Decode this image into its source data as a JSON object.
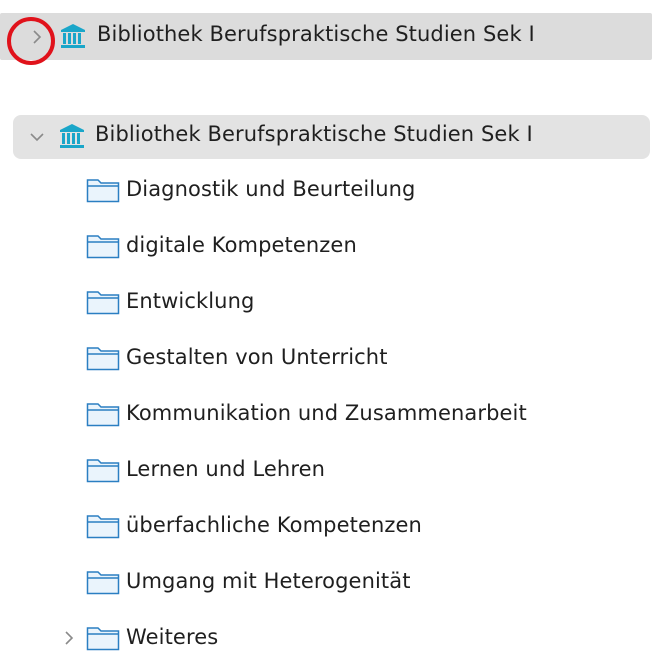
{
  "top_row": {
    "label": "Bibliothek Berufspraktische Studien Sek I",
    "chevron_icon": "chevron-right-icon",
    "library_icon": "library-icon"
  },
  "tree": {
    "library": {
      "label": "Bibliothek Berufspraktische Studien Sek I",
      "chevron_icon": "chevron-down-icon",
      "library_icon": "library-icon"
    },
    "folders": [
      {
        "label": "Diagnostik und Beurteilung"
      },
      {
        "label": "digitale Kompetenzen"
      },
      {
        "label": "Entwicklung"
      },
      {
        "label": "Gestalten von Unterricht"
      },
      {
        "label": "Kommunikation und Zusammenarbeit"
      },
      {
        "label": "Lernen und Lehren"
      },
      {
        "label": "überfachliche Kompetenzen"
      },
      {
        "label": "Umgang mit Heterogenität"
      },
      {
        "label": "Weiteres"
      }
    ]
  },
  "colors": {
    "row_selected_bg": "#dcdcdc",
    "row_hover_bg": "#e3e3e3",
    "library_icon": "#1aa6c9",
    "folder_icon_stroke": "#2b7fc2",
    "folder_icon_fill": "#eaf4fc",
    "highlight_circle": "#e0121b",
    "chevron": "#8a8a8a"
  }
}
